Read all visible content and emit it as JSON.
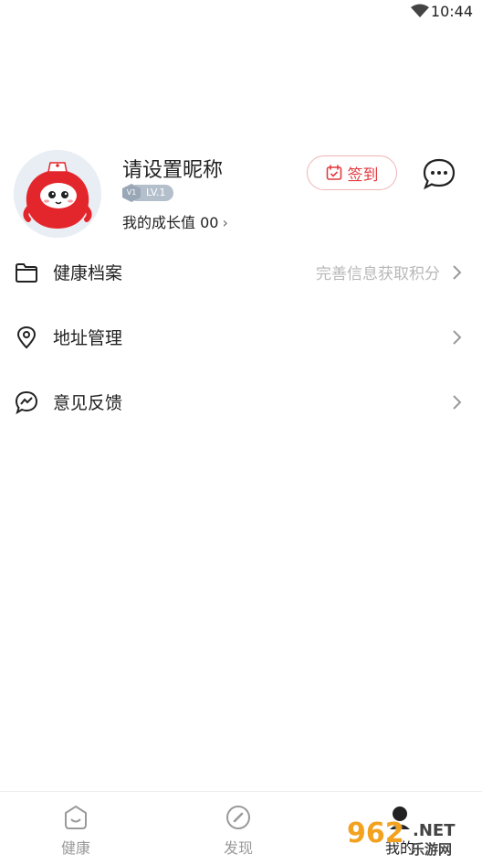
{
  "status_bar": {
    "time": "10:44"
  },
  "profile": {
    "nickname": "请设置昵称",
    "level_badge": "V1",
    "level": "LV.1",
    "growth_text": "我的成长值 00",
    "signin_label": "签到"
  },
  "menu": [
    {
      "label": "健康档案",
      "hint": "完善信息获取积分",
      "icon": "folder-icon"
    },
    {
      "label": "地址管理",
      "hint": "",
      "icon": "location-pin-icon"
    },
    {
      "label": "意见反馈",
      "hint": "",
      "icon": "feedback-icon"
    }
  ],
  "tabbar": {
    "tabs": [
      {
        "label": "健康",
        "icon": "health-face-icon"
      },
      {
        "label": "发现",
        "icon": "compass-icon"
      },
      {
        "label": "我的",
        "icon": "profile-icon"
      }
    ]
  },
  "watermark": {
    "number": "962",
    "net": ".NET",
    "cn": "乐游网"
  },
  "colors": {
    "accent": "#e23a40",
    "hint": "#b8b8b8"
  }
}
